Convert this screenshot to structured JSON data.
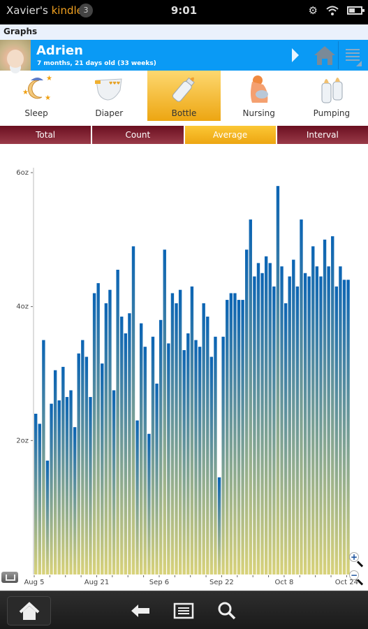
{
  "status_bar": {
    "owner_prefix": "Xavier's ",
    "owner_brand": "kindle",
    "notification_count": "3",
    "time": "9:01",
    "icons": [
      "gear-icon",
      "wifi-icon",
      "battery-icon"
    ]
  },
  "title_bar": {
    "title": "Graphs"
  },
  "profile": {
    "name": "Adrien",
    "age": "7 months, 21 days old (33 weeks)",
    "accent_color": "#0a9af5"
  },
  "categories": [
    {
      "label": "Sleep",
      "icon": "sleep-moon-icon",
      "active": false
    },
    {
      "label": "Diaper",
      "icon": "diaper-icon",
      "active": false
    },
    {
      "label": "Bottle",
      "icon": "bottle-icon",
      "active": true
    },
    {
      "label": "Nursing",
      "icon": "nursing-icon",
      "active": false
    },
    {
      "label": "Pumping",
      "icon": "pumping-bottles-icon",
      "active": false
    }
  ],
  "tabs": [
    {
      "label": "Total",
      "active": false
    },
    {
      "label": "Count",
      "active": false
    },
    {
      "label": "Average",
      "active": true
    },
    {
      "label": "Interval",
      "active": false
    }
  ],
  "chart_data": {
    "type": "bar",
    "title": "",
    "xlabel": "",
    "ylabel": "",
    "ylim": [
      0,
      6
    ],
    "y_ticks": [
      {
        "value": 2,
        "label": "2oz"
      },
      {
        "value": 4,
        "label": "4oz"
      },
      {
        "value": 6,
        "label": "6oz"
      }
    ],
    "x_tick_labels": [
      "Aug 5",
      "Aug 21",
      "Sep 6",
      "Sep 22",
      "Oct 8",
      "Oct 24"
    ],
    "x_label_interval_days": 16,
    "start_date": "Aug 5",
    "end_date": "Oct 24",
    "series": [
      {
        "name": "Average bottle (oz)",
        "colors": {
          "top": "#0a64b4",
          "bottom": "#d8d27a"
        },
        "values": [
          2.4,
          2.25,
          3.5,
          1.7,
          2.55,
          3.05,
          2.6,
          3.1,
          2.65,
          2.75,
          2.2,
          3.3,
          3.5,
          3.25,
          2.65,
          4.2,
          4.35,
          3.15,
          4.05,
          4.25,
          2.75,
          4.55,
          3.85,
          3.6,
          3.9,
          4.9,
          2.3,
          3.75,
          3.4,
          2.1,
          3.55,
          2.85,
          3.8,
          4.85,
          3.45,
          4.2,
          4.05,
          4.25,
          3.35,
          3.6,
          4.3,
          3.5,
          3.4,
          4.05,
          3.85,
          3.25,
          3.55,
          1.45,
          3.55,
          4.1,
          4.2,
          4.2,
          4.1,
          4.1,
          4.85,
          5.3,
          4.45,
          4.65,
          4.5,
          4.75,
          4.65,
          4.3,
          5.8,
          4.6,
          4.05,
          4.45,
          4.7,
          4.3,
          5.3,
          4.5,
          4.45,
          4.9,
          4.6,
          4.45,
          5.0,
          4.6,
          5.05,
          4.3,
          4.6,
          4.4,
          4.4
        ]
      }
    ],
    "grid": false,
    "legend": "none"
  },
  "chart_controls": {
    "share_icon": "share-icon",
    "zoom_in_icon": "zoom-in-icon",
    "zoom_out_icon": "zoom-out-icon"
  },
  "nav_bar": {
    "items": [
      "home-icon",
      "back-arrow-icon",
      "menu-icon",
      "search-icon"
    ]
  }
}
